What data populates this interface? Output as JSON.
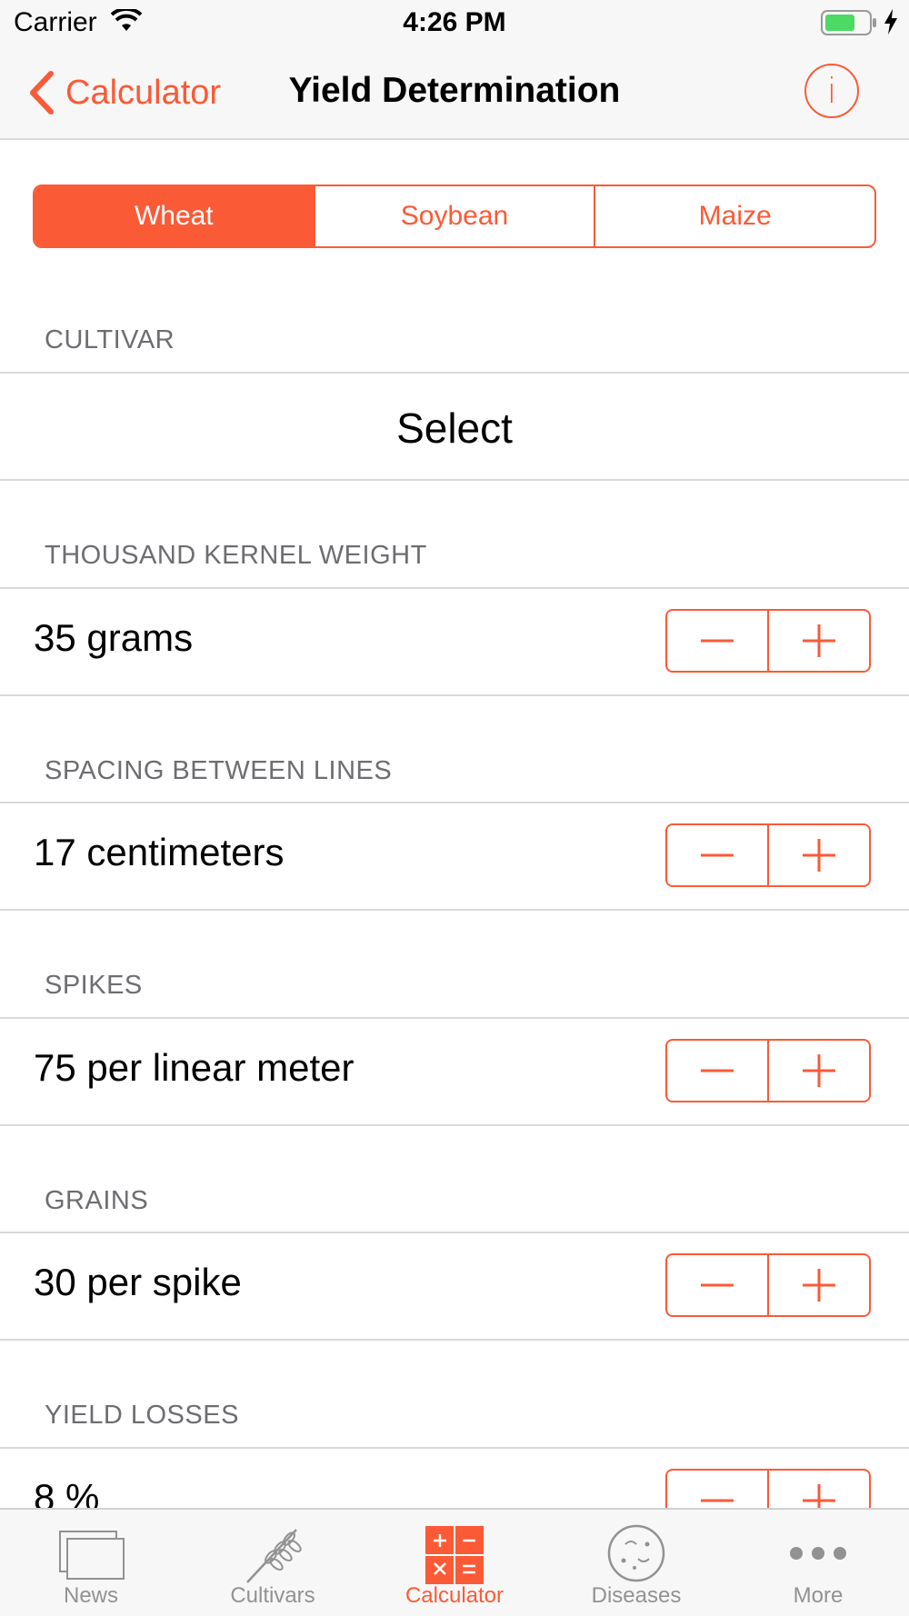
{
  "status_bar": {
    "carrier": "Carrier",
    "time": "4:26 PM"
  },
  "nav": {
    "back_label": "Calculator",
    "title": "Yield Determination"
  },
  "segments": [
    "Wheat",
    "Soybean",
    "Maize"
  ],
  "selected_segment": "Wheat",
  "cultivar": {
    "header": "CULTIVAR",
    "value": "Select"
  },
  "fields": [
    {
      "header": "THOUSAND KERNEL WEIGHT",
      "value": "35 grams"
    },
    {
      "header": "SPACING BETWEEN LINES",
      "value": "17 centimeters"
    },
    {
      "header": "SPIKES",
      "value": "75 per linear meter"
    },
    {
      "header": "GRAINS",
      "value": "30 per spike"
    },
    {
      "header": "YIELD LOSSES",
      "value": "8 %"
    }
  ],
  "tabs": [
    {
      "label": "News",
      "icon": "news-icon"
    },
    {
      "label": "Cultivars",
      "icon": "wheat-icon"
    },
    {
      "label": "Calculator",
      "icon": "calculator-icon"
    },
    {
      "label": "Diseases",
      "icon": "petri-dish-icon"
    },
    {
      "label": "More",
      "icon": "more-dots-icon"
    }
  ],
  "active_tab": "Calculator",
  "colors": {
    "accent": "#fb5a36",
    "inactive": "#929292",
    "header_text": "#6d6d72",
    "bars": "#f7f7f7"
  }
}
